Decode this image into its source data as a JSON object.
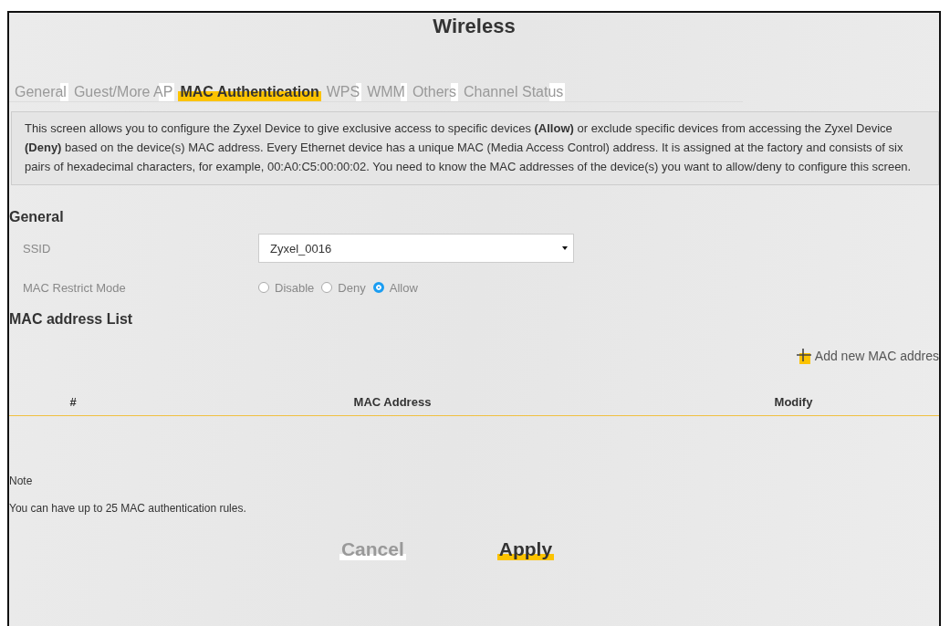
{
  "window": {
    "title": "Wireless"
  },
  "tabs": [
    {
      "label": "General",
      "selected": false
    },
    {
      "label": "Guest/More AP",
      "selected": false
    },
    {
      "label": "MAC Authentication",
      "selected": true
    },
    {
      "label": "WPS",
      "selected": false
    },
    {
      "label": "WMM",
      "selected": false
    },
    {
      "label": "Others",
      "selected": false
    },
    {
      "label": "Channel Status",
      "selected": false
    }
  ],
  "description": "This screen allows you to configure the Zyxel Device to give exclusive access to specific devices **(Allow)** or exclude specific devices from accessing the Zyxel Device **(Deny)** based on the device(s) MAC address. Every Ethernet device has a unique MAC (Media Access Control) address. It is assigned at the factory and consists of six pairs of hexadecimal characters, for example, 00:A0:C5:00:00:02. You need to know the MAC addresses of the device(s) you want to allow/deny to configure this screen.",
  "general": {
    "heading": "General",
    "ssid": {
      "label": "SSID",
      "value": "Zyxel_0016"
    },
    "restrict_mode": {
      "label": "MAC Restrict Mode",
      "options": [
        {
          "label": "Disable",
          "selected": false
        },
        {
          "label": "Deny",
          "selected": false
        },
        {
          "label": "Allow",
          "selected": true
        }
      ]
    }
  },
  "mac_list": {
    "heading": "MAC address List",
    "add_link": "Add new MAC addres",
    "columns": [
      "#",
      "MAC Address",
      "Modify"
    ]
  },
  "note": {
    "heading": "Note",
    "text": "You can have up to 25 MAC authentication rules."
  },
  "buttons": [
    {
      "label": "Cancel",
      "kind": "secondary"
    },
    {
      "label": "Apply",
      "kind": "primary"
    }
  ]
}
